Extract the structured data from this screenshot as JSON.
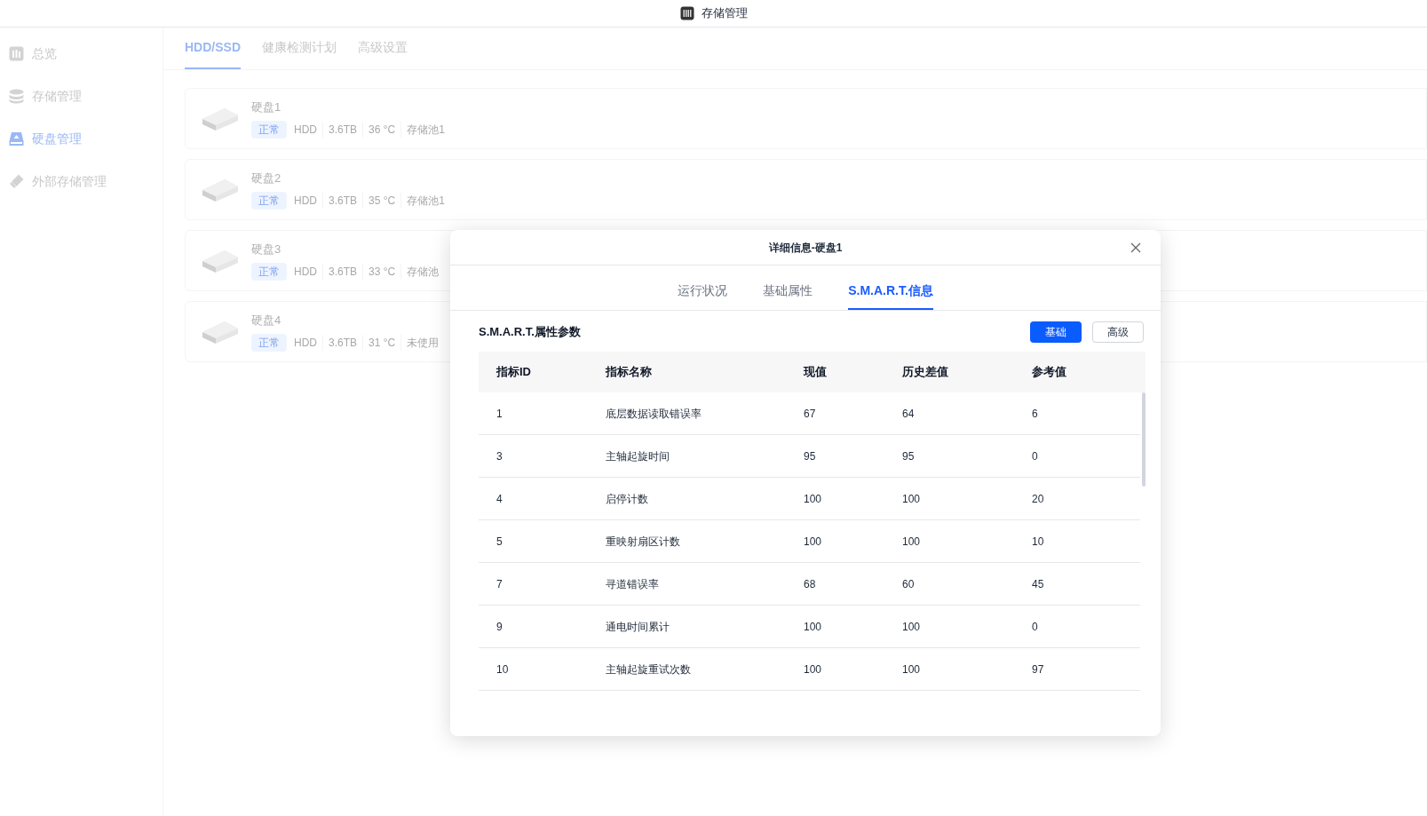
{
  "window": {
    "title": "存储管理"
  },
  "sidebar": {
    "items": [
      {
        "label": "总览",
        "selected": false
      },
      {
        "label": "存储管理",
        "selected": false
      },
      {
        "label": "硬盘管理",
        "selected": true
      },
      {
        "label": "外部存储管理",
        "selected": false
      }
    ]
  },
  "tabs": [
    {
      "label": "HDD/SSD",
      "selected": true
    },
    {
      "label": "健康检测计划",
      "selected": false
    },
    {
      "label": "高级设置",
      "selected": false
    }
  ],
  "disks": [
    {
      "name": "硬盘1",
      "status": "正常",
      "type": "HDD",
      "capacity": "3.6TB",
      "temperature": "36 °C",
      "pool": "存储池1"
    },
    {
      "name": "硬盘2",
      "status": "正常",
      "type": "HDD",
      "capacity": "3.6TB",
      "temperature": "35 °C",
      "pool": "存储池1"
    },
    {
      "name": "硬盘3",
      "status": "正常",
      "type": "HDD",
      "capacity": "3.6TB",
      "temperature": "33 °C",
      "pool": "存储池"
    },
    {
      "name": "硬盘4",
      "status": "正常",
      "type": "HDD",
      "capacity": "3.6TB",
      "temperature": "31 °C",
      "pool": "未使用"
    }
  ],
  "dialog": {
    "title": "详细信息-硬盘1",
    "tabs": [
      {
        "label": "运行状况",
        "selected": false
      },
      {
        "label": "基础属性",
        "selected": false
      },
      {
        "label": "S.M.A.R.T.信息",
        "selected": true
      }
    ],
    "section_title": "S.M.A.R.T.属性参数",
    "mode_buttons": [
      {
        "label": "基础",
        "selected": true
      },
      {
        "label": "高级",
        "selected": false
      }
    ],
    "table": {
      "columns": [
        "指标ID",
        "指标名称",
        "现值",
        "历史差值",
        "参考值"
      ],
      "rows": [
        [
          "1",
          "底层数据读取错误率",
          "67",
          "64",
          "6"
        ],
        [
          "3",
          "主轴起旋时间",
          "95",
          "95",
          "0"
        ],
        [
          "4",
          "启停计数",
          "100",
          "100",
          "20"
        ],
        [
          "5",
          "重映射扇区计数",
          "100",
          "100",
          "10"
        ],
        [
          "7",
          "寻道错误率",
          "68",
          "60",
          "45"
        ],
        [
          "9",
          "通电时间累计",
          "100",
          "100",
          "0"
        ],
        [
          "10",
          "主轴起旋重试次数",
          "100",
          "100",
          "97"
        ]
      ]
    }
  }
}
